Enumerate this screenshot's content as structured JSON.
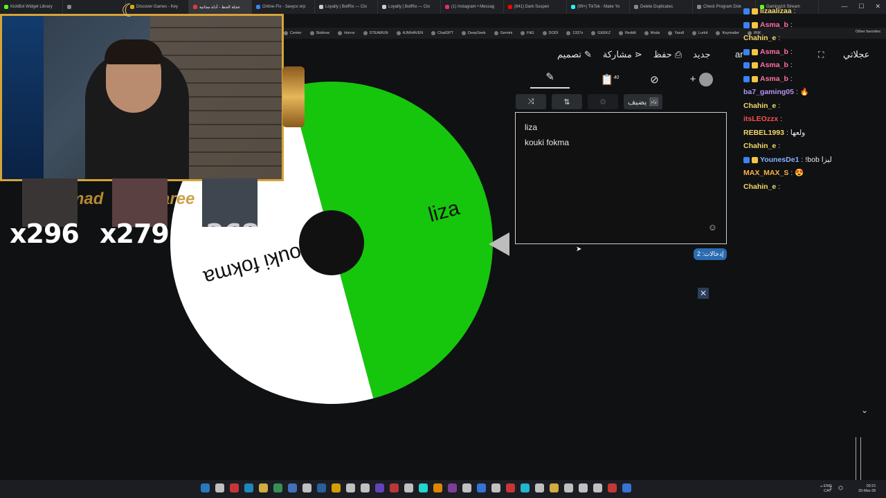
{
  "browser": {
    "tabs": [
      {
        "title": "KickBot Widget Library",
        "color": "#53fc18"
      },
      {
        "title": "",
        "color": "#888888"
      },
      {
        "title": "Discover Games - Key",
        "color": "#e0a800"
      },
      {
        "title": "عجلة الحظ - أداة مجانية",
        "color": "#e33b3b",
        "active": true
      },
      {
        "title": "Online-Fix - Занусх игр",
        "color": "#3b82f6"
      },
      {
        "title": "Loyalty | BotRix — Clo",
        "color": "#cccccc"
      },
      {
        "title": "Loyalty | BotRix — Clo",
        "color": "#cccccc"
      },
      {
        "title": "(1) Instagram • Messag",
        "color": "#e1306c"
      },
      {
        "title": "(841) Dark Suspen",
        "color": "#ff0000"
      },
      {
        "title": "(99+) TikTok - Make Yo",
        "color": "#25f4ee"
      },
      {
        "title": "Delete Duplicates",
        "color": "#888888"
      },
      {
        "title": "Check Program Disk",
        "color": "#888888"
      },
      {
        "title": "Gaming16 Stream",
        "color": "#53fc18"
      }
    ],
    "bookmarks": [
      "Center",
      "Skidrow",
      "Horror",
      "STEAMUN",
      "AJMHAVEN",
      "ChatGPT",
      "DeepSeek",
      "Gemini",
      "FitG",
      "DODI",
      "1337x",
      "GEEKZ",
      "Reddit",
      "Mods",
      "Yandl",
      "Lurkit",
      "Keymailer",
      "IRIK"
    ],
    "other_favorites": "Other favorites"
  },
  "app": {
    "logo": "عجلاتي",
    "lang": "ar",
    "toolbar": [
      {
        "label": "جديد",
        "icon": "new-icon"
      },
      {
        "label": "حفظ",
        "icon": "save-icon"
      },
      {
        "label": "مشاركة",
        "icon": "share-icon"
      },
      {
        "label": "تصميم",
        "icon": "pencil-icon"
      }
    ],
    "panel_badge": "40",
    "add_image_label": "يضيف",
    "entries": [
      "liza",
      "kouki fokma"
    ],
    "entries_count_label": "إدخالات: 2"
  },
  "wheel": {
    "segments": [
      {
        "label": "liza",
        "color": "#16c60c",
        "text_color": "#111111"
      },
      {
        "label": "kouki fokma",
        "color": "#ffffff",
        "text_color": "#111111"
      }
    ]
  },
  "overlay": {
    "background_names": [
      "mad",
      "aree"
    ],
    "leaders": [
      {
        "count": "x296"
      },
      {
        "count": "x279"
      },
      {
        "count": "x268"
      }
    ]
  },
  "chat": [
    {
      "user": "lizaalizaa",
      "color": "#f6d96b",
      "msg": ""
    },
    {
      "user": "Asma_b",
      "color": "#ff6fa5",
      "msg": ""
    },
    {
      "user": "Chahin_e",
      "color": "#f6d96b",
      "msg": ""
    },
    {
      "user": "Asma_b",
      "color": "#ff6fa5",
      "msg": ""
    },
    {
      "user": "Asma_b",
      "color": "#ff6fa5",
      "msg": ""
    },
    {
      "user": "Asma_b",
      "color": "#ff6fa5",
      "msg": ""
    },
    {
      "user": "ba7_gaming05",
      "color": "#b794f4",
      "msg": "🔥"
    },
    {
      "user": "Chahin_e",
      "color": "#f6d96b",
      "msg": ""
    },
    {
      "user": "itsLEOzzx",
      "color": "#ff4d4d",
      "msg": ""
    },
    {
      "user": "REBEL1993",
      "color": "#f6d96b",
      "msg": "ولعها"
    },
    {
      "user": "Chahin_e",
      "color": "#f6d96b",
      "msg": ""
    },
    {
      "user": "YounesDe1",
      "color": "#8ab4ff",
      "msg": "!bob ليزا"
    },
    {
      "user": "MAX_MAX_S",
      "color": "#ffb347",
      "msg": "😍"
    },
    {
      "user": "Chahin_e",
      "color": "#f6d96b",
      "msg": ""
    }
  ],
  "taskbar": {
    "lang": [
      "ENG",
      "CAT"
    ],
    "time": "03:21",
    "date": "20-Mar-26"
  }
}
